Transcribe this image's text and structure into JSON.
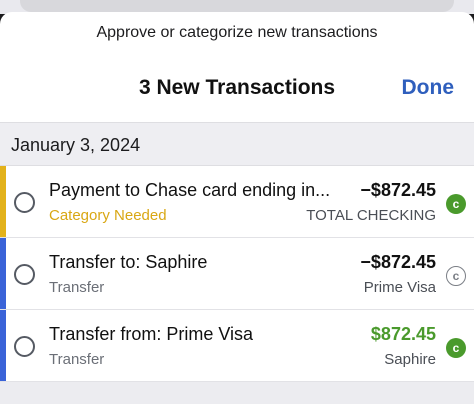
{
  "header": {
    "prompt": "Approve or categorize new transactions",
    "title": "3 New Transactions",
    "done_label": "Done"
  },
  "section": {
    "date": "January 3, 2024"
  },
  "colors": {
    "needs_category": "#e3b21b",
    "transfer": "#3a63d8",
    "cleared": "#4a9a2c",
    "accent": "#2f5fbd"
  },
  "transactions": [
    {
      "payee": "Payment to Chase card ending in...",
      "category": "Category Needed",
      "amount": "−$872.45",
      "account": "TOTAL CHECKING",
      "cleared_icon": "c-filled-icon"
    },
    {
      "payee": "Transfer to: Saphire",
      "category": "Transfer",
      "amount": "−$872.45",
      "account": "Prime Visa",
      "cleared_icon": "c-outline-icon"
    },
    {
      "payee": "Transfer from: Prime Visa",
      "category": "Transfer",
      "amount": "$872.45",
      "account": "Saphire",
      "cleared_icon": "c-filled-icon"
    }
  ]
}
